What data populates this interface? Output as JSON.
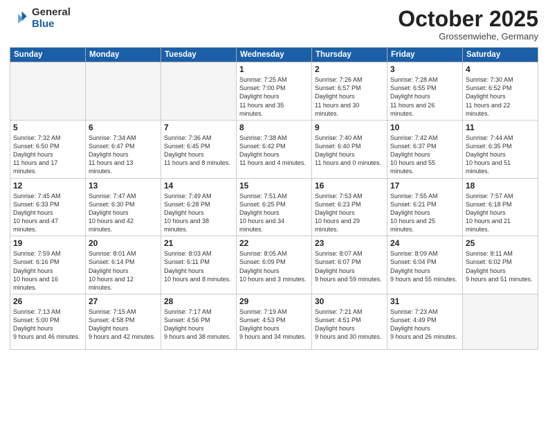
{
  "logo": {
    "general": "General",
    "blue": "Blue"
  },
  "header": {
    "month": "October 2025",
    "location": "Grossenwiehe, Germany"
  },
  "weekdays": [
    "Sunday",
    "Monday",
    "Tuesday",
    "Wednesday",
    "Thursday",
    "Friday",
    "Saturday"
  ],
  "weeks": [
    [
      {
        "day": "",
        "empty": true
      },
      {
        "day": "",
        "empty": true
      },
      {
        "day": "",
        "empty": true
      },
      {
        "day": "1",
        "sunrise": "7:25 AM",
        "sunset": "7:00 PM",
        "daylight": "11 hours and 35 minutes."
      },
      {
        "day": "2",
        "sunrise": "7:26 AM",
        "sunset": "6:57 PM",
        "daylight": "11 hours and 30 minutes."
      },
      {
        "day": "3",
        "sunrise": "7:28 AM",
        "sunset": "6:55 PM",
        "daylight": "11 hours and 26 minutes."
      },
      {
        "day": "4",
        "sunrise": "7:30 AM",
        "sunset": "6:52 PM",
        "daylight": "11 hours and 22 minutes."
      }
    ],
    [
      {
        "day": "5",
        "sunrise": "7:32 AM",
        "sunset": "6:50 PM",
        "daylight": "11 hours and 17 minutes."
      },
      {
        "day": "6",
        "sunrise": "7:34 AM",
        "sunset": "6:47 PM",
        "daylight": "11 hours and 13 minutes."
      },
      {
        "day": "7",
        "sunrise": "7:36 AM",
        "sunset": "6:45 PM",
        "daylight": "11 hours and 8 minutes."
      },
      {
        "day": "8",
        "sunrise": "7:38 AM",
        "sunset": "6:42 PM",
        "daylight": "11 hours and 4 minutes."
      },
      {
        "day": "9",
        "sunrise": "7:40 AM",
        "sunset": "6:40 PM",
        "daylight": "11 hours and 0 minutes."
      },
      {
        "day": "10",
        "sunrise": "7:42 AM",
        "sunset": "6:37 PM",
        "daylight": "10 hours and 55 minutes."
      },
      {
        "day": "11",
        "sunrise": "7:44 AM",
        "sunset": "6:35 PM",
        "daylight": "10 hours and 51 minutes."
      }
    ],
    [
      {
        "day": "12",
        "sunrise": "7:45 AM",
        "sunset": "6:33 PM",
        "daylight": "10 hours and 47 minutes."
      },
      {
        "day": "13",
        "sunrise": "7:47 AM",
        "sunset": "6:30 PM",
        "daylight": "10 hours and 42 minutes."
      },
      {
        "day": "14",
        "sunrise": "7:49 AM",
        "sunset": "6:28 PM",
        "daylight": "10 hours and 38 minutes."
      },
      {
        "day": "15",
        "sunrise": "7:51 AM",
        "sunset": "6:25 PM",
        "daylight": "10 hours and 34 minutes."
      },
      {
        "day": "16",
        "sunrise": "7:53 AM",
        "sunset": "6:23 PM",
        "daylight": "10 hours and 29 minutes."
      },
      {
        "day": "17",
        "sunrise": "7:55 AM",
        "sunset": "6:21 PM",
        "daylight": "10 hours and 25 minutes."
      },
      {
        "day": "18",
        "sunrise": "7:57 AM",
        "sunset": "6:18 PM",
        "daylight": "10 hours and 21 minutes."
      }
    ],
    [
      {
        "day": "19",
        "sunrise": "7:59 AM",
        "sunset": "6:16 PM",
        "daylight": "10 hours and 16 minutes."
      },
      {
        "day": "20",
        "sunrise": "8:01 AM",
        "sunset": "6:14 PM",
        "daylight": "10 hours and 12 minutes."
      },
      {
        "day": "21",
        "sunrise": "8:03 AM",
        "sunset": "6:11 PM",
        "daylight": "10 hours and 8 minutes."
      },
      {
        "day": "22",
        "sunrise": "8:05 AM",
        "sunset": "6:09 PM",
        "daylight": "10 hours and 3 minutes."
      },
      {
        "day": "23",
        "sunrise": "8:07 AM",
        "sunset": "6:07 PM",
        "daylight": "9 hours and 59 minutes."
      },
      {
        "day": "24",
        "sunrise": "8:09 AM",
        "sunset": "6:04 PM",
        "daylight": "9 hours and 55 minutes."
      },
      {
        "day": "25",
        "sunrise": "8:11 AM",
        "sunset": "6:02 PM",
        "daylight": "9 hours and 51 minutes."
      }
    ],
    [
      {
        "day": "26",
        "sunrise": "7:13 AM",
        "sunset": "5:00 PM",
        "daylight": "9 hours and 46 minutes."
      },
      {
        "day": "27",
        "sunrise": "7:15 AM",
        "sunset": "4:58 PM",
        "daylight": "9 hours and 42 minutes."
      },
      {
        "day": "28",
        "sunrise": "7:17 AM",
        "sunset": "4:56 PM",
        "daylight": "9 hours and 38 minutes."
      },
      {
        "day": "29",
        "sunrise": "7:19 AM",
        "sunset": "4:53 PM",
        "daylight": "9 hours and 34 minutes."
      },
      {
        "day": "30",
        "sunrise": "7:21 AM",
        "sunset": "4:51 PM",
        "daylight": "9 hours and 30 minutes."
      },
      {
        "day": "31",
        "sunrise": "7:23 AM",
        "sunset": "4:49 PM",
        "daylight": "9 hours and 26 minutes."
      },
      {
        "day": "",
        "empty": true
      }
    ]
  ]
}
